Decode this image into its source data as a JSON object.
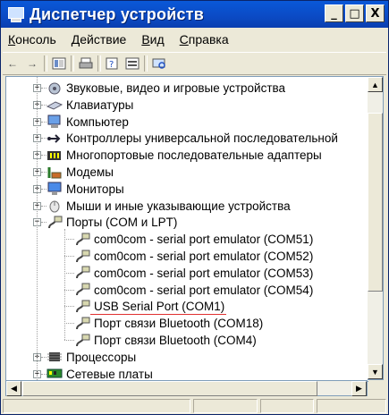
{
  "window": {
    "title": "Диспетчер устройств"
  },
  "titlebar": {
    "min": "_",
    "max": "□",
    "close": "X"
  },
  "menu": [
    {
      "label": "Консоль",
      "key": "К"
    },
    {
      "label": "Действие",
      "key": "Д"
    },
    {
      "label": "Вид",
      "key": "В"
    },
    {
      "label": "Справка",
      "key": "С"
    }
  ],
  "tree": {
    "items": [
      {
        "label": "Звуковые, видео и игровые устройства",
        "expander": "+",
        "icon": "speaker-icon"
      },
      {
        "label": "Клавиатуры",
        "expander": "+",
        "icon": "keyboard-icon"
      },
      {
        "label": "Компьютер",
        "expander": "+",
        "icon": "computer-icon"
      },
      {
        "label": "Контроллеры универсальной последовательной",
        "expander": "+",
        "icon": "usb-icon"
      },
      {
        "label": "Многопортовые последовательные адаптеры",
        "expander": "+",
        "icon": "multiport-icon"
      },
      {
        "label": "Модемы",
        "expander": "+",
        "icon": "modem-icon"
      },
      {
        "label": "Мониторы",
        "expander": "+",
        "icon": "monitor-icon"
      },
      {
        "label": "Мыши и иные указывающие устройства",
        "expander": "+",
        "icon": "mouse-icon"
      },
      {
        "label": "Порты (COM и LPT)",
        "expander": "−",
        "icon": "port-icon"
      },
      {
        "label": "com0com - serial port emulator (COM51)",
        "child": true,
        "icon": "port-icon"
      },
      {
        "label": "com0com - serial port emulator (COM52)",
        "child": true,
        "icon": "port-icon"
      },
      {
        "label": "com0com - serial port emulator (COM53)",
        "child": true,
        "icon": "port-icon"
      },
      {
        "label": "com0com - serial port emulator (COM54)",
        "child": true,
        "icon": "port-icon"
      },
      {
        "label": "USB Serial Port (COM1)",
        "child": true,
        "icon": "port-icon",
        "highlight": "#e03030"
      },
      {
        "label": "Порт связи Bluetooth (COM18)",
        "child": true,
        "icon": "port-icon"
      },
      {
        "label": "Порт связи Bluetooth (COM4)",
        "child": true,
        "icon": "port-icon"
      },
      {
        "label": "Процессоры",
        "expander": "+",
        "icon": "cpu-icon"
      },
      {
        "label": "Сетевые платы",
        "expander": "+",
        "icon": "network-card-icon"
      }
    ]
  },
  "colors": {
    "titlebar": "#0a4ac4",
    "highlight": "#e03030"
  }
}
